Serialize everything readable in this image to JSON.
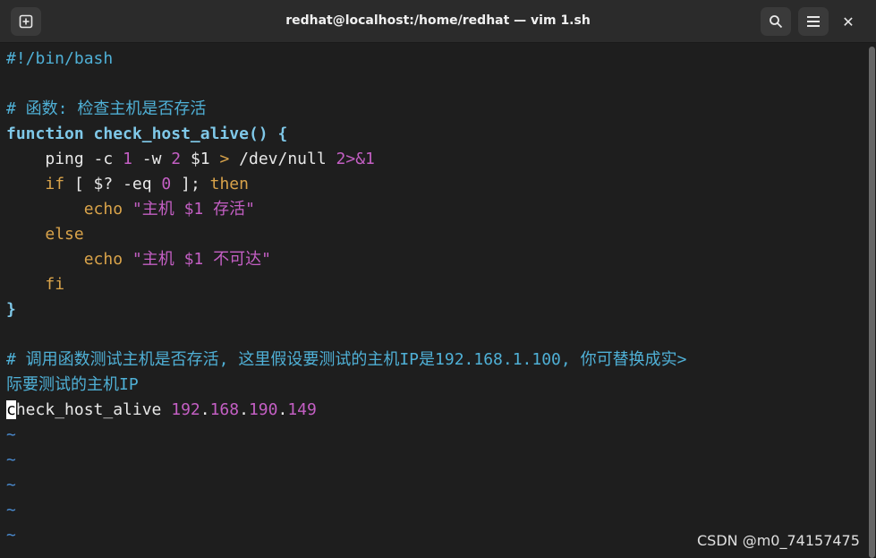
{
  "window": {
    "title": "redhat@localhost:/home/redhat — vim 1.sh",
    "close_glyph": "✕"
  },
  "code": {
    "shebang": "#!/bin/bash",
    "comment1": "# 函数: 检查主机是否存活",
    "func_kw": "function",
    "func_name": "check_host_alive",
    "func_open": "() {",
    "l_ping": "ping -c ",
    "l_ping_n1": "1",
    "l_ping_w": " -w ",
    "l_ping_n2": "2",
    "l_ping_arg": " $1 ",
    "l_ping_gt": ">",
    "l_ping_null": " /dev/null ",
    "l_ping_redir": "2>&1",
    "l_if": "if",
    "l_if_test": " [ $? -eq ",
    "l_if_zero": "0",
    "l_if_end": " ]; ",
    "l_then": "then",
    "l_echo1": "echo",
    "l_echo1_str": "\"主机 $1 存活\"",
    "l_else": "else",
    "l_echo2": "echo",
    "l_echo2_str": "\"主机 $1 不可达\"",
    "l_fi": "fi",
    "l_close": "}",
    "comment2_a": "# 调用函数测试主机是否存活, 这里假设要测试的主机IP是192.168.1.100, 你可替换成实>",
    "comment2_b": "际要测试的主机IP",
    "call_cursor": "c",
    "call_rest": "heck_host_alive ",
    "ip_1": "192",
    "ip_d1": ".",
    "ip_2": "168",
    "ip_d2": ".",
    "ip_3": "190",
    "ip_d3": ".",
    "ip_4": "149",
    "tilde": "~"
  },
  "watermark": "CSDN @m0_74157475",
  "colors": {
    "background": "#1e1e1e",
    "comment": "#4fb0d6",
    "keyword": "#7fc8e8",
    "control": "#d9a34a",
    "number": "#c45fc4",
    "tilde": "#4a8bd0"
  }
}
